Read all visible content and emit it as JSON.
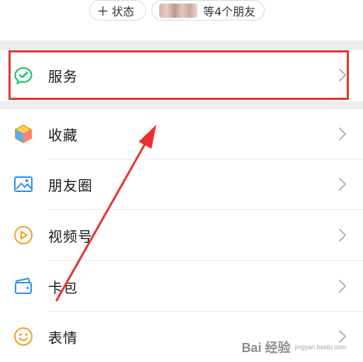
{
  "top": {
    "status_label": "状态",
    "friends_label": "等4个朋友"
  },
  "menu": {
    "items": [
      {
        "label": "服务",
        "icon": "service-icon"
      },
      {
        "label": "收藏",
        "icon": "favorites-icon"
      },
      {
        "label": "朋友圈",
        "icon": "moments-icon"
      },
      {
        "label": "视频号",
        "icon": "channels-icon"
      },
      {
        "label": "卡包",
        "icon": "cards-icon"
      },
      {
        "label": "表情",
        "icon": "sticker-icon"
      }
    ]
  },
  "watermark": {
    "text": "Bai 经验",
    "sub": "jingyan.baidu.com"
  },
  "colors": {
    "highlight": "#e8322f",
    "service_green": "#07c160",
    "separator": "#ededed"
  }
}
